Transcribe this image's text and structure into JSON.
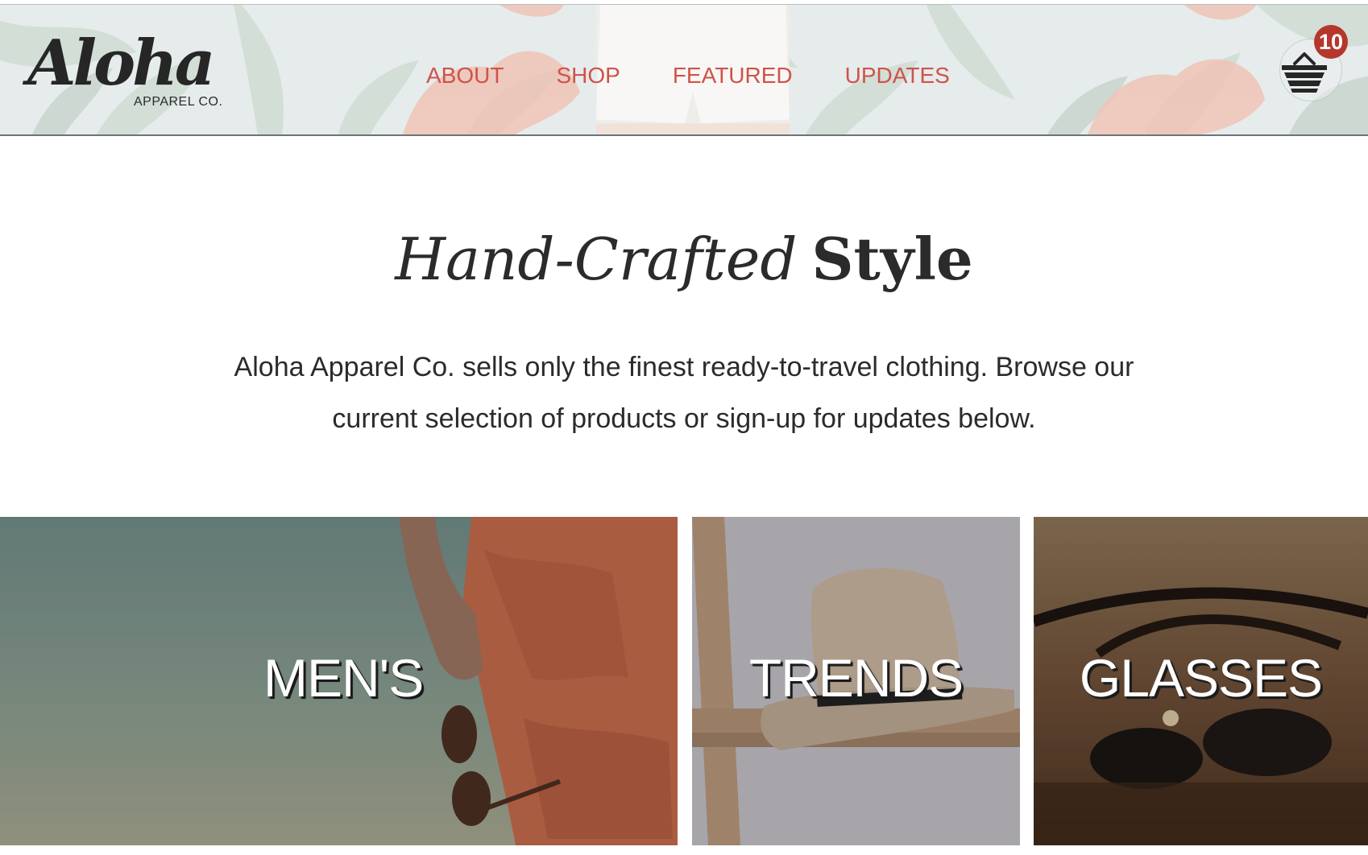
{
  "brand": {
    "logo_script": "Aloha",
    "logo_sub": "APPAREL CO."
  },
  "nav": {
    "items": [
      {
        "label": "ABOUT"
      },
      {
        "label": "SHOP"
      },
      {
        "label": "FEATURED"
      },
      {
        "label": "UPDATES"
      }
    ]
  },
  "cart": {
    "icon": "basket-icon",
    "count": "10"
  },
  "hero": {
    "title_italic": "Hand-Crafted",
    "title_bold": "Style",
    "intro": "Aloha Apparel Co. sells only the finest ready-to-travel clothing. Browse our current selection of products or sign-up for updates below."
  },
  "categories": [
    {
      "label": "MEN'S"
    },
    {
      "label": "TRENDS"
    },
    {
      "label": "GLASSES"
    }
  ],
  "colors": {
    "accent": "#cf5348",
    "badge": "#b5372c",
    "text": "#2b2b2b"
  }
}
